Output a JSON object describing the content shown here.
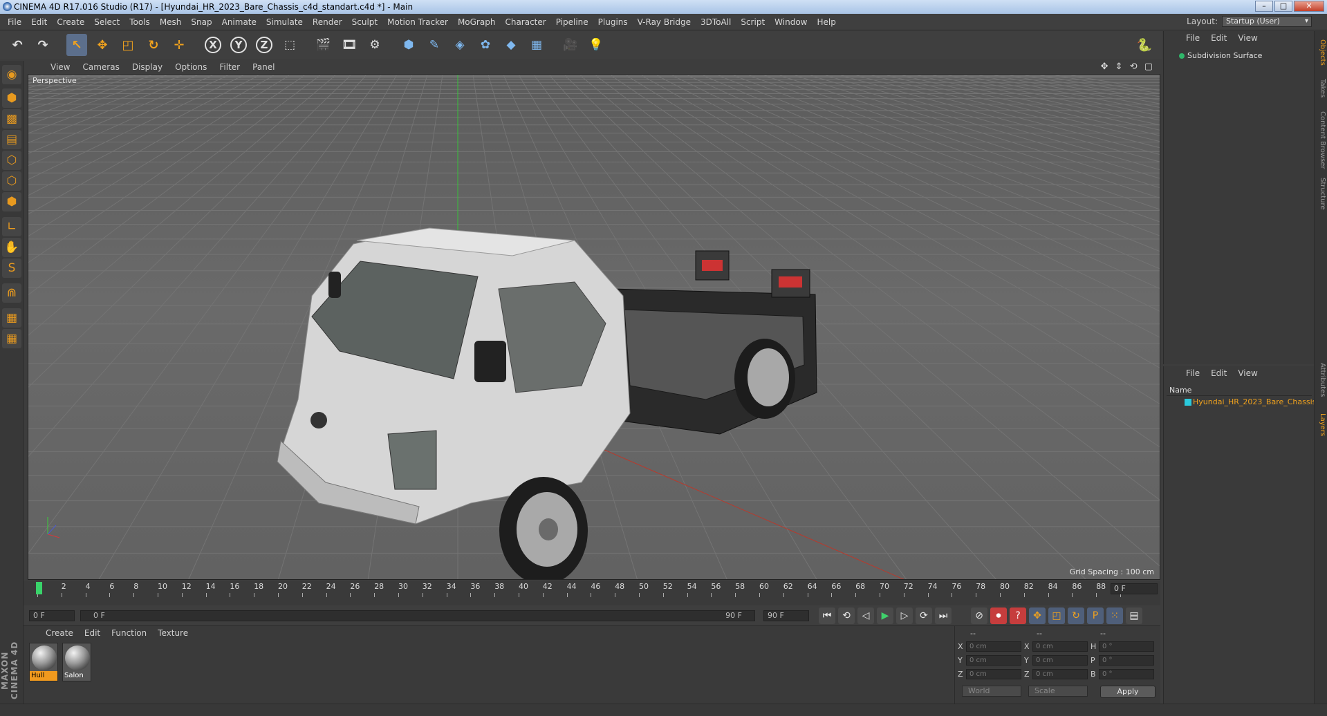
{
  "window": {
    "title": "CINEMA 4D R17.016 Studio (R17) - [Hyundai_HR_2023_Bare_Chassis_c4d_standart.c4d *] - Main",
    "min": "–",
    "max": "□",
    "close": "✕"
  },
  "menu": [
    "File",
    "Edit",
    "Create",
    "Select",
    "Tools",
    "Mesh",
    "Snap",
    "Animate",
    "Simulate",
    "Render",
    "Sculpt",
    "Motion Tracker",
    "MoGraph",
    "Character",
    "Pipeline",
    "Plugins",
    "V-Ray Bridge",
    "3DToAll",
    "Script",
    "Window",
    "Help"
  ],
  "layout": {
    "label": "Layout:",
    "value": "Startup (User)"
  },
  "toolbar": {
    "icons": [
      {
        "name": "undo-icon",
        "glyph": "↶"
      },
      {
        "name": "redo-icon",
        "glyph": "↷"
      },
      {
        "name": "select-icon",
        "glyph": "↖"
      },
      {
        "name": "move-icon",
        "glyph": "✥"
      },
      {
        "name": "scale-icon",
        "glyph": "◰"
      },
      {
        "name": "rotate-icon",
        "glyph": "↻"
      },
      {
        "name": "live-select-icon",
        "glyph": "✛"
      }
    ],
    "axes": [
      "X",
      "Y",
      "Z"
    ],
    "icons2": [
      {
        "name": "coordinate-system-icon",
        "glyph": "⬚"
      },
      {
        "name": "render-view-icon",
        "glyph": "🎬"
      },
      {
        "name": "render-picture-viewer-icon",
        "glyph": "🎞"
      },
      {
        "name": "render-settings-icon",
        "glyph": "⚙"
      },
      {
        "name": "cube-icon",
        "glyph": "⬢"
      },
      {
        "name": "pen-spline-icon",
        "glyph": "✎"
      },
      {
        "name": "subdivision-icon",
        "glyph": "◈"
      },
      {
        "name": "mograph-cloner-icon",
        "glyph": "✿"
      },
      {
        "name": "deformer-icon",
        "glyph": "◆"
      },
      {
        "name": "floor-icon",
        "glyph": "▦"
      },
      {
        "name": "camera-icon",
        "glyph": "🎥"
      },
      {
        "name": "light-icon",
        "glyph": "💡"
      }
    ],
    "python": "python-icon"
  },
  "lefttools": [
    {
      "name": "make-editable-icon",
      "glyph": "◉"
    },
    {
      "name": "model-mode-icon",
      "glyph": "⬢"
    },
    {
      "name": "texture-mode-icon",
      "glyph": "▩"
    },
    {
      "name": "workplane-icon",
      "glyph": "▤"
    },
    {
      "name": "points-mode-icon",
      "glyph": "⬡"
    },
    {
      "name": "edges-mode-icon",
      "glyph": "⬡"
    },
    {
      "name": "polygons-mode-icon",
      "glyph": "⬢"
    },
    {
      "name": "axis-mode-icon",
      "glyph": "∟"
    },
    {
      "name": "tweak-mode-icon",
      "glyph": "✋"
    },
    {
      "name": "snap-icon",
      "glyph": "S"
    },
    {
      "name": "magnet-icon",
      "glyph": "⋒"
    },
    {
      "name": "lock-workplane-icon",
      "glyph": "▦"
    },
    {
      "name": "planar-workplane-icon",
      "glyph": "▦"
    }
  ],
  "maxon": "MAXON CINEMA 4D",
  "viewport": {
    "menu": [
      "View",
      "Cameras",
      "Display",
      "Options",
      "Filter",
      "Panel"
    ],
    "label": "Perspective",
    "grid_spacing": "Grid Spacing : 100 cm",
    "nav": "✥ ⇕ ⟲ ▢"
  },
  "timeline": {
    "ticks": [
      "0",
      "2",
      "4",
      "6",
      "8",
      "10",
      "12",
      "14",
      "16",
      "18",
      "20",
      "22",
      "24",
      "26",
      "28",
      "30",
      "32",
      "34",
      "36",
      "38",
      "40",
      "42",
      "44",
      "46",
      "48",
      "50",
      "52",
      "54",
      "56",
      "58",
      "60",
      "62",
      "64",
      "66",
      "68",
      "70",
      "72",
      "74",
      "76",
      "78",
      "80",
      "82",
      "84",
      "86",
      "88",
      "90"
    ],
    "current": "0 F"
  },
  "transport": {
    "start": "0 F",
    "range_start": "0 F",
    "range_end": "90 F",
    "end": "90 F",
    "buttons": [
      {
        "name": "goto-start-button",
        "glyph": "⏮"
      },
      {
        "name": "prev-key-button",
        "glyph": "⟲"
      },
      {
        "name": "prev-frame-button",
        "glyph": "◁"
      },
      {
        "name": "play-button",
        "glyph": "▶"
      },
      {
        "name": "next-frame-button",
        "glyph": "▷"
      },
      {
        "name": "next-key-button",
        "glyph": "⟳"
      },
      {
        "name": "goto-end-button",
        "glyph": "⏭"
      }
    ],
    "keys": [
      {
        "name": "motion-record-icon",
        "glyph": "⊘"
      },
      {
        "name": "record-key-icon",
        "glyph": "⏺"
      },
      {
        "name": "autokey-icon",
        "glyph": "?"
      },
      {
        "name": "key-position-icon",
        "glyph": "✥"
      },
      {
        "name": "key-scale-icon",
        "glyph": "◰"
      },
      {
        "name": "key-rotation-icon",
        "glyph": "↻"
      },
      {
        "name": "key-param-icon",
        "glyph": "P"
      },
      {
        "name": "key-pla-icon",
        "glyph": "⁙"
      },
      {
        "name": "timeline-icon",
        "glyph": "▤"
      }
    ]
  },
  "materials": {
    "menu": [
      "Create",
      "Edit",
      "Function",
      "Texture"
    ],
    "items": [
      {
        "name": "Hull"
      },
      {
        "name": "Salon"
      }
    ]
  },
  "attributes": {
    "header": [
      "--",
      "--",
      "--"
    ],
    "rows": [
      {
        "a": "X",
        "av": "0 cm",
        "b": "X",
        "bv": "0 cm",
        "c": "H",
        "cv": "0 °"
      },
      {
        "a": "Y",
        "av": "0 cm",
        "b": "Y",
        "bv": "0 cm",
        "c": "P",
        "cv": "0 °"
      },
      {
        "a": "Z",
        "av": "0 cm",
        "b": "Z",
        "bv": "0 cm",
        "c": "B",
        "cv": "0 °"
      }
    ],
    "coord_system": "World",
    "mode": "Scale",
    "apply": "Apply"
  },
  "objects": {
    "menu": [
      "File",
      "Edit",
      "View"
    ],
    "items": [
      {
        "name": "Subdivision Surface"
      }
    ]
  },
  "layers": {
    "menu": [
      "File",
      "Edit",
      "View"
    ],
    "header": "Name",
    "items": [
      {
        "name": "Hyundai_HR_2023_Bare_Chassis",
        "color": "#2ac9dc"
      }
    ]
  },
  "righttabs": [
    "Objects",
    "Takes",
    "Content Browser",
    "Structure",
    "Attributes",
    "Layers"
  ]
}
